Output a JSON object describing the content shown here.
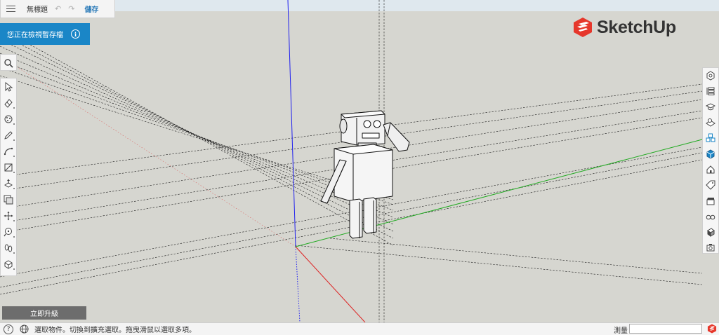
{
  "app": {
    "title": "無標題",
    "save_label": "儲存",
    "undo_icon": "undo-icon",
    "redo_icon": "redo-icon",
    "menu_icon": "hamburger-menu-icon"
  },
  "banner": {
    "text": "您正在檢視暫存檔",
    "info_icon": "info-icon",
    "color": "#1a86c7"
  },
  "logo": {
    "text": "SketchUp",
    "color": "#e6372b"
  },
  "left_toolbar": {
    "search_icon": "search-icon",
    "tools": [
      {
        "name": "select-tool",
        "icon": "arrow-cursor-icon"
      },
      {
        "name": "eraser-tool",
        "icon": "eraser-icon"
      },
      {
        "name": "paint-bucket-tool",
        "icon": "paint-icon"
      },
      {
        "name": "pencil-line-tool",
        "icon": "pencil-icon"
      },
      {
        "name": "arc-tool",
        "icon": "arc-icon"
      },
      {
        "name": "rectangle-tool",
        "icon": "rectangle-icon"
      },
      {
        "name": "push-pull-tool",
        "icon": "push-pull-icon"
      },
      {
        "name": "offset-tool",
        "icon": "offset-icon"
      },
      {
        "name": "move-tool",
        "icon": "move-icon"
      },
      {
        "name": "tape-measure-tool",
        "icon": "tape-measure-icon"
      },
      {
        "name": "walk-tool",
        "icon": "footprints-icon"
      },
      {
        "name": "orbit-tool",
        "icon": "orbit-icon"
      }
    ]
  },
  "right_panel": {
    "items": [
      {
        "name": "entity-info-panel",
        "icon": "cube-info-icon"
      },
      {
        "name": "outliner-panel",
        "icon": "outliner-icon"
      },
      {
        "name": "instructor-panel",
        "icon": "graduation-cap-icon"
      },
      {
        "name": "materials-panel",
        "icon": "materials-icon"
      },
      {
        "name": "components-panel",
        "icon": "components-icon"
      },
      {
        "name": "3d-warehouse-panel",
        "icon": "cube-icon"
      },
      {
        "name": "scenes-panel",
        "icon": "house-icon"
      },
      {
        "name": "tags-panel",
        "icon": "tag-icon"
      },
      {
        "name": "animation-panel",
        "icon": "clapperboard-icon"
      },
      {
        "name": "display-panel",
        "icon": "glasses-icon"
      },
      {
        "name": "styles-panel",
        "icon": "styles-icon"
      },
      {
        "name": "shadows-panel",
        "icon": "camera-icon"
      }
    ]
  },
  "upgrade": {
    "label": "立即升級"
  },
  "status": {
    "help_icon": "help-icon",
    "globe_icon": "globe-icon",
    "hint": "選取物件。切換到擴充選取。拖曳滑鼠以選取多項。",
    "measure_label": "測量",
    "measure_value": ""
  },
  "colors": {
    "viewport": "#d6d6d0",
    "axis_blue": "#2222ee",
    "axis_red": "#dd2222",
    "axis_green": "#22aa22"
  }
}
